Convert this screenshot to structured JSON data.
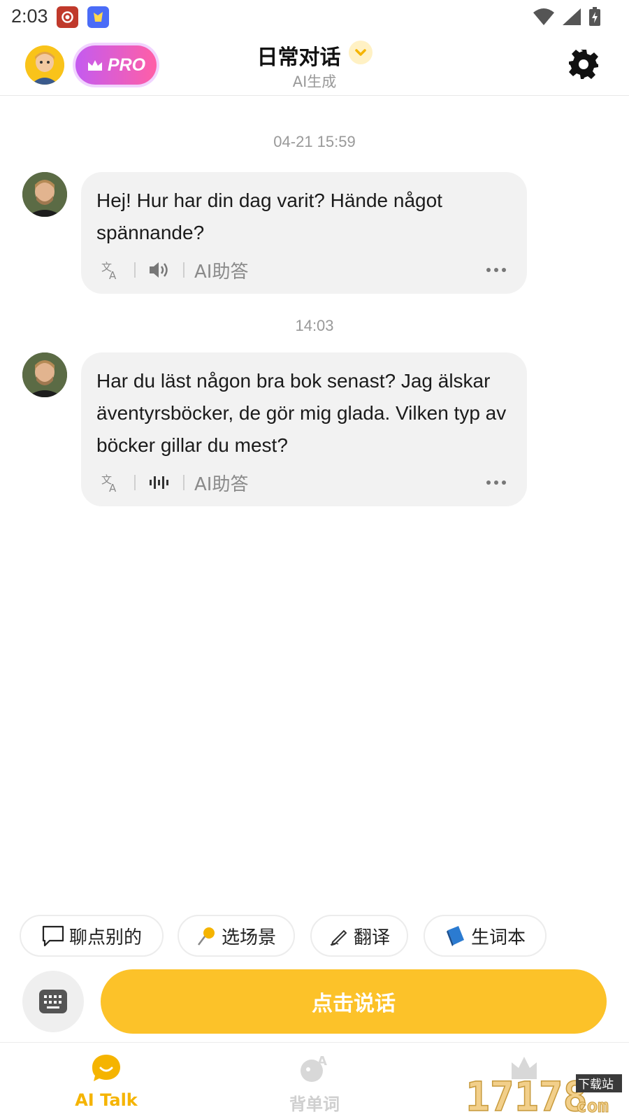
{
  "status_bar": {
    "time": "2:03",
    "icons": [
      "app-icon-1",
      "app-icon-2",
      "wifi-icon",
      "signal-icon",
      "battery-charging-icon"
    ]
  },
  "header": {
    "title": "日常对话",
    "subtitle": "AI生成",
    "pro_label": "PRO",
    "icons": [
      "user-avatar",
      "crown-icon",
      "chevron-down-icon",
      "gear-icon"
    ]
  },
  "messages": [
    {
      "timestamp": "04-21 15:59",
      "text": "Hej! Hur har din dag varit? Hände något spännande?",
      "ai_label": "AI助答",
      "audio_state": "speaker-icon"
    },
    {
      "timestamp": "14:03",
      "text": "Har du läst någon bra bok senast? Jag älskar äventyrsböcker, de gör mig glada. Vilken typ av böcker gillar du mest?",
      "ai_label": "AI助答",
      "audio_state": "sound-wave-icon"
    }
  ],
  "chips": [
    {
      "label": "聊点别的",
      "icon": "chat-bubble-icon"
    },
    {
      "label": "选场景",
      "icon": "pin-icon"
    },
    {
      "label": "翻译",
      "icon": "pen-icon"
    },
    {
      "label": "生词本",
      "icon": "book-icon"
    }
  ],
  "input": {
    "speak_label": "点击说话",
    "keyboard_icon": "keyboard-icon"
  },
  "bottom_nav": [
    {
      "label": "AI Talk",
      "icon": "chat-face-icon",
      "active": true
    },
    {
      "label": "背单词",
      "icon": "word-icon",
      "active": false
    },
    {
      "label": "",
      "icon": "crown-icon",
      "active": false
    }
  ],
  "watermark": {
    "text": "17178",
    "sub": "下载站",
    "com": "com"
  },
  "colors": {
    "accent": "#fcc229",
    "active_nav": "#f5b400",
    "bubble_bg": "#f2f2f2",
    "pro_gradient_start": "#c45bf0",
    "pro_gradient_end": "#ff5fa6"
  }
}
